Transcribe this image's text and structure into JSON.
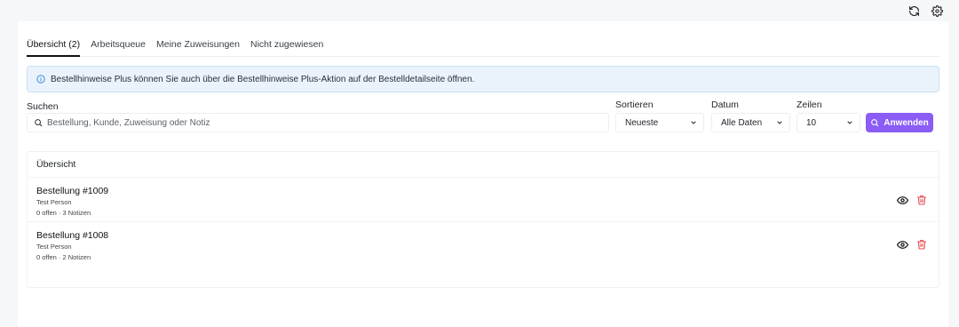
{
  "toolbar": {
    "refresh_icon": "refresh-icon",
    "settings_icon": "gear-icon"
  },
  "tabs": [
    {
      "label": "Übersicht (2)",
      "active": true
    },
    {
      "label": "Arbeitsqueue",
      "active": false
    },
    {
      "label": "Meine Zuweisungen",
      "active": false
    },
    {
      "label": "Nicht zugewiesen",
      "active": false
    }
  ],
  "notice": {
    "text": "Bestellhinweise Plus können Sie auch über die Bestellhinweise Plus-Aktion auf der Bestelldetailseite öffnen."
  },
  "filters": {
    "search_label": "Suchen",
    "search_placeholder": "Bestellung, Kunde, Zuweisung oder Notiz",
    "sort_label": "Sortieren",
    "sort_value": "Neueste",
    "date_label": "Datum",
    "date_value": "Alle Daten",
    "rows_label": "Zeilen",
    "rows_value": "10",
    "apply_label": "Anwenden"
  },
  "overview": {
    "title": "Übersicht",
    "orders": [
      {
        "title": "Bestellung #1009",
        "customer": "Test Person",
        "meta": "0 offen · 3 Notizen"
      },
      {
        "title": "Bestellung #1008",
        "customer": "Test Person",
        "meta": "0 offen · 2 Notizen"
      }
    ]
  },
  "colors": {
    "accent": "#8b5cf6",
    "danger": "#e5484d",
    "notice_bg": "#eaf3fc"
  }
}
